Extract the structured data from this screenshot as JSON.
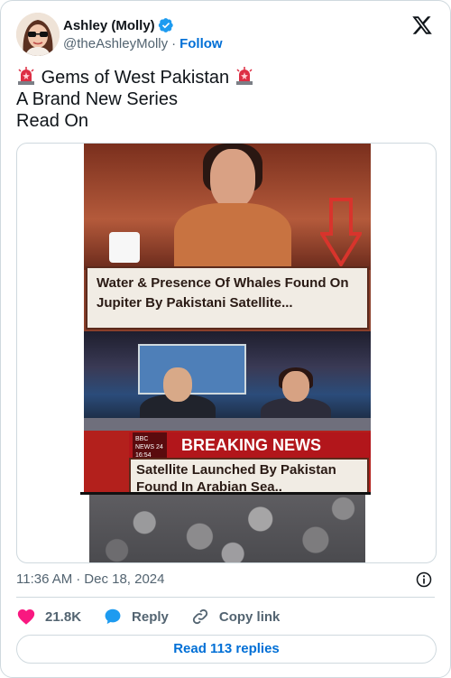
{
  "author": {
    "display_name": "Ashley (Molly)",
    "handle": "@theAshleyMolly",
    "separator": "·",
    "follow_label": "Follow",
    "verified_color": "#1d9bf0"
  },
  "post": {
    "line1_text": "Gems of West Pakistan",
    "line2_text": "A Brand New Series",
    "line3_text": "Read On",
    "emoji": "rotating-light"
  },
  "media": {
    "caption1": "Water & Presence Of Whales Found On Jupiter By Pakistani Satellite...",
    "breaking_label": "BREAKING NEWS",
    "bbc_text": "BBC NEWS 24 16:54",
    "caption2": "Satellite Launched By Pakistan Found In Arabian Sea.."
  },
  "meta": {
    "time": "11:36 AM",
    "separator": "·",
    "date": "Dec 18, 2024"
  },
  "actions": {
    "likes": "21.8K",
    "reply_label": "Reply",
    "copy_label": "Copy link"
  },
  "footer": {
    "read_replies_label": "Read 113 replies"
  },
  "colors": {
    "accent": "#006fd6",
    "like": "#f91880",
    "reply_icon": "#1d9bf0",
    "muted": "#536471"
  }
}
